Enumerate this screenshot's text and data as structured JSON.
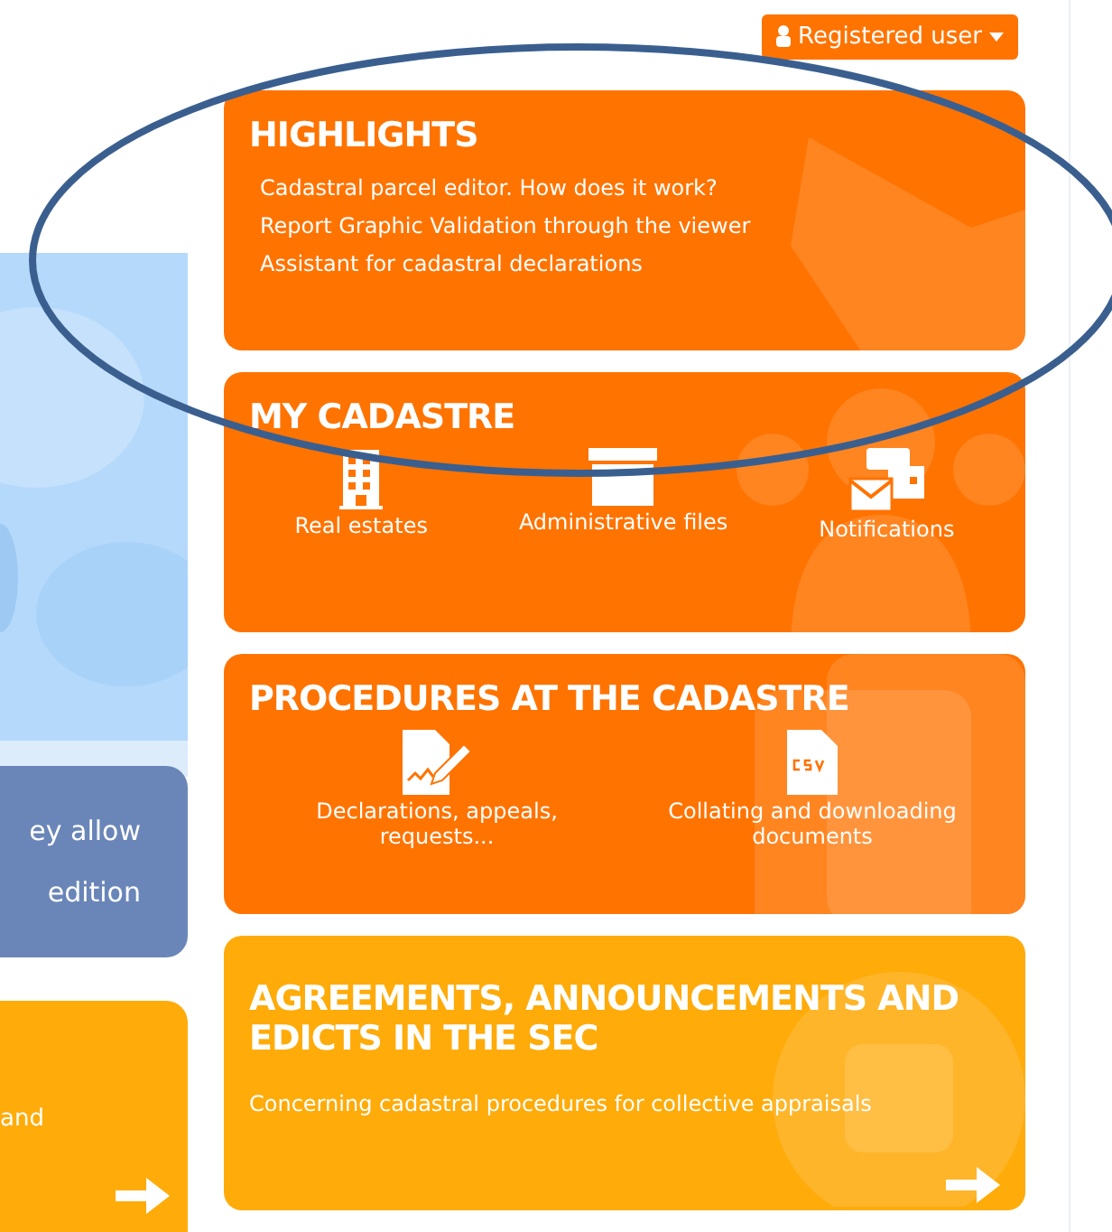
{
  "user_menu": {
    "label": "Registered user"
  },
  "left_column": {
    "info_card": {
      "lines": [
        "ey allow",
        "edition"
      ]
    },
    "promo_card": {
      "text": "and"
    }
  },
  "panels": [
    {
      "kind": "links",
      "color": "#ff7300",
      "title": "HIGHLIGHTS",
      "links": [
        "Cadastral parcel editor. How does it work?",
        "Report Graphic Validation through the viewer",
        "Assistant for cadastral declarations"
      ]
    },
    {
      "kind": "shortcuts",
      "color": "#ff7300",
      "title": "MY CADASTRE",
      "items": [
        "Real estates",
        "Administrative files",
        "Notifications"
      ]
    },
    {
      "kind": "shortcuts",
      "color": "#ff7300",
      "title": "PROCEDURES AT THE CADASTRE",
      "items": [
        "Declarations, appeals, requests...",
        "Collating and downloading documents"
      ]
    },
    {
      "kind": "promo",
      "color": "#ffab0a",
      "title": "AGREEMENTS, ANNOUNCEMENTS AND EDICTS IN THE SEC",
      "text": "Concerning cadastral procedures for collective appraisals"
    }
  ]
}
